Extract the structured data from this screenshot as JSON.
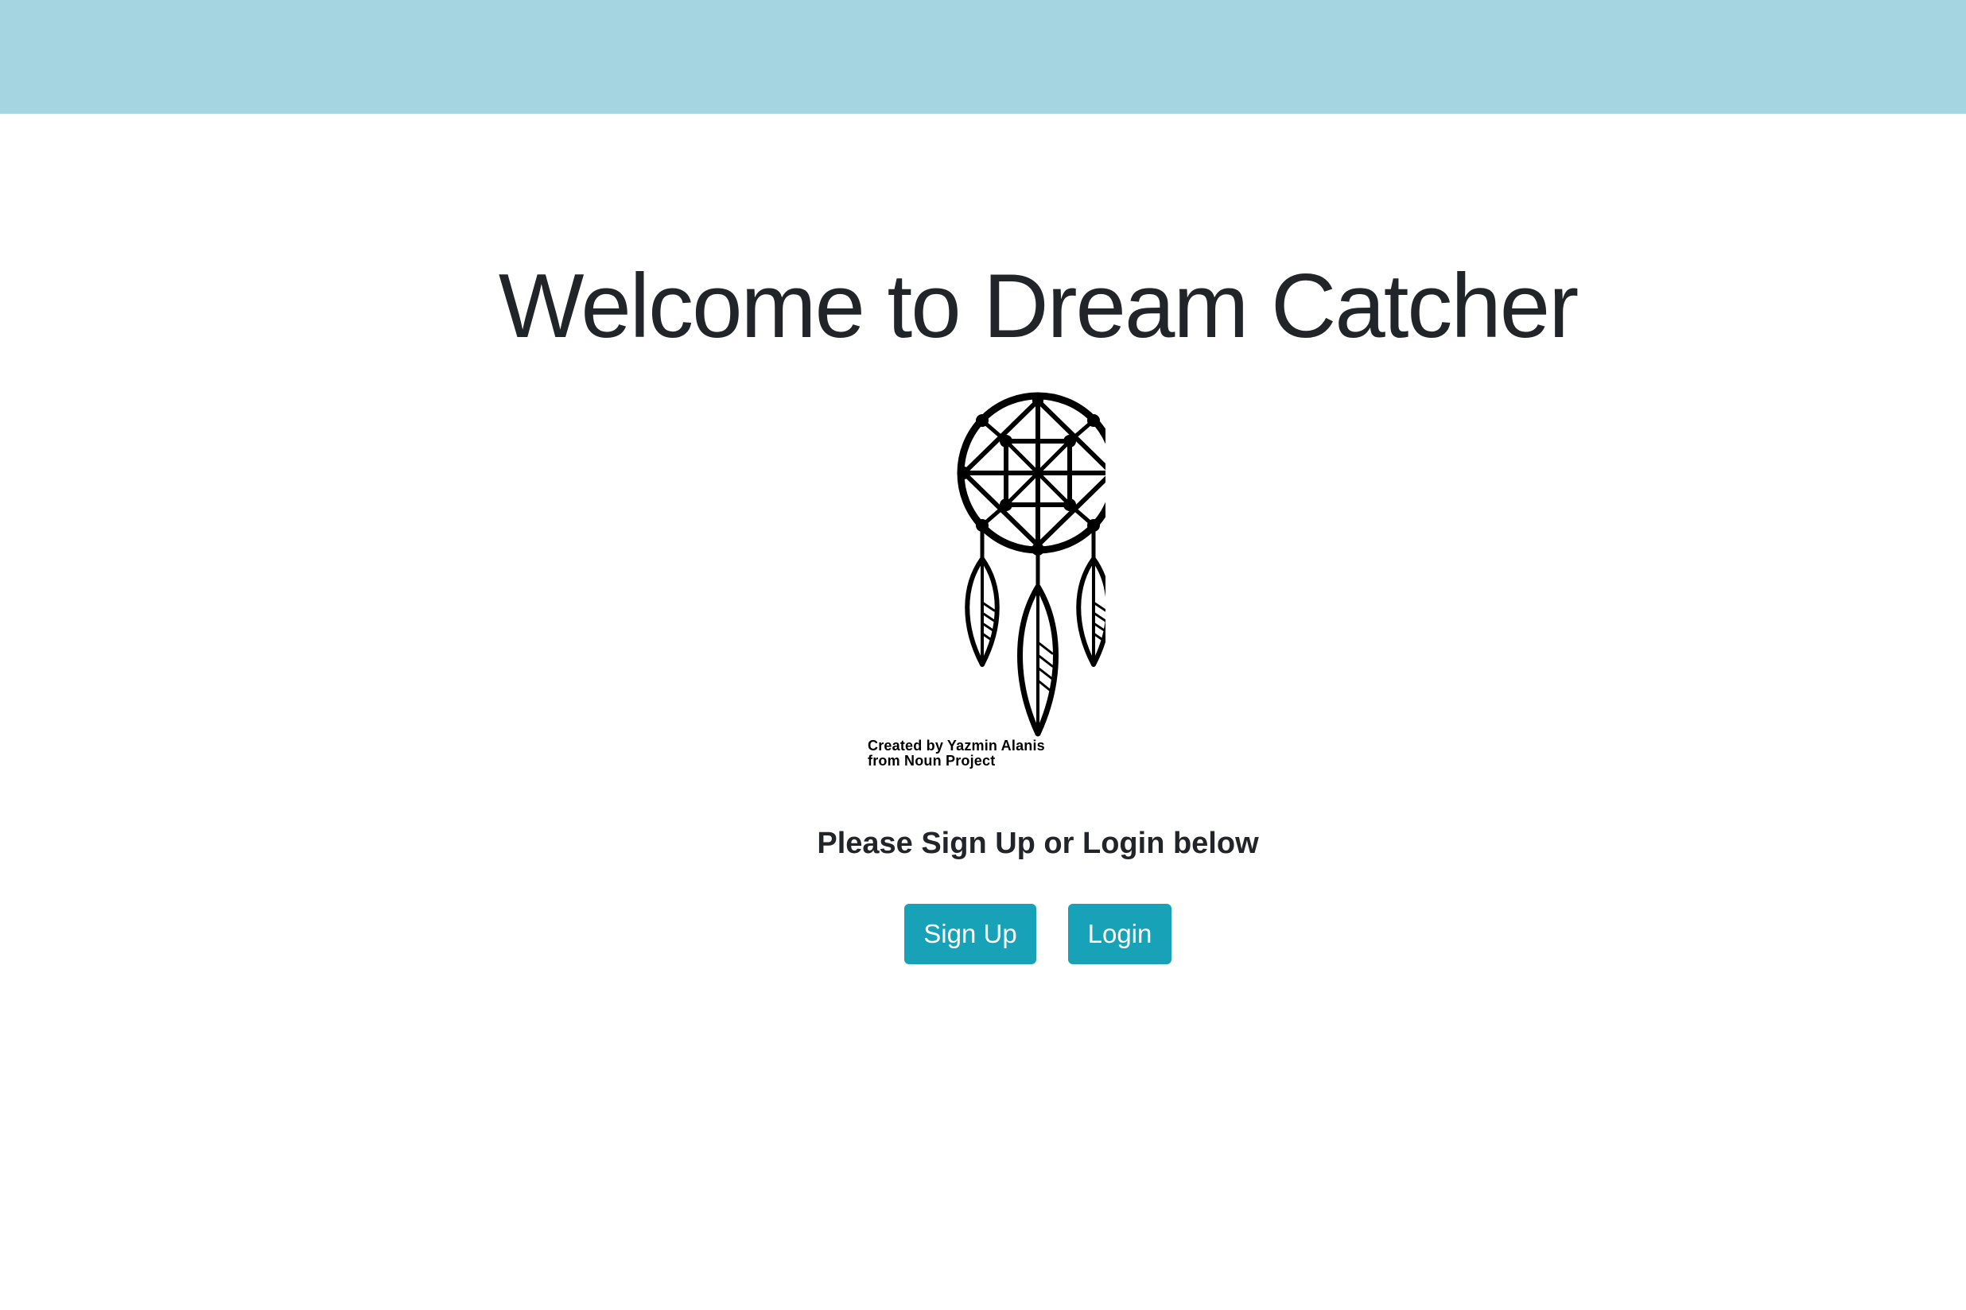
{
  "navbar": {
    "color": "#a6d5e2"
  },
  "main": {
    "title": "Welcome to Dream Catcher",
    "logo": {
      "icon": "dream-catcher-icon",
      "credit_line1": "Created by Yazmin Alanis",
      "credit_line2": "from Noun Project"
    },
    "prompt": "Please Sign Up or Login below",
    "buttons": {
      "signup_label": "Sign Up",
      "login_label": "Login",
      "color": "#17a2b8"
    }
  }
}
